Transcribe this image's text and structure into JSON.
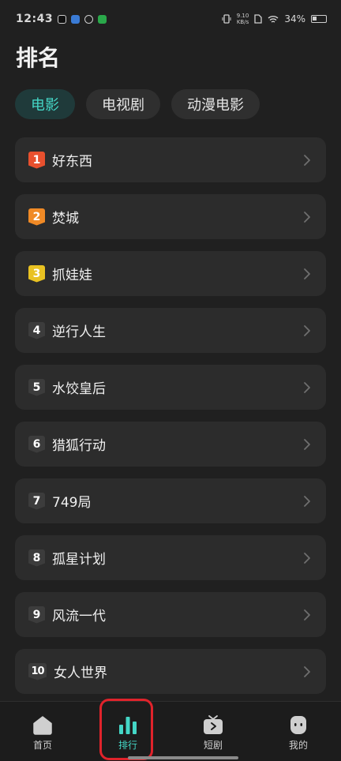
{
  "status": {
    "time": "12:43",
    "net_speed_value": "9.10",
    "net_speed_unit": "KB/s",
    "battery": "34%"
  },
  "page_title": "排名",
  "tabs": [
    {
      "label": "电影",
      "active": true
    },
    {
      "label": "电视剧",
      "active": false
    },
    {
      "label": "动漫电影",
      "active": false
    }
  ],
  "ranking": [
    {
      "rank": "1",
      "title": "好东西"
    },
    {
      "rank": "2",
      "title": "焚城"
    },
    {
      "rank": "3",
      "title": "抓娃娃"
    },
    {
      "rank": "4",
      "title": "逆行人生"
    },
    {
      "rank": "5",
      "title": "水饺皇后"
    },
    {
      "rank": "6",
      "title": "猎狐行动"
    },
    {
      "rank": "7",
      "title": "749局"
    },
    {
      "rank": "8",
      "title": "孤星计划"
    },
    {
      "rank": "9",
      "title": "风流一代"
    },
    {
      "rank": "10",
      "title": "女人世界"
    }
  ],
  "bottom_nav": [
    {
      "label": "首页",
      "icon": "home-icon",
      "active": false
    },
    {
      "label": "排行",
      "icon": "bar-chart-icon",
      "active": true
    },
    {
      "label": "短剧",
      "icon": "tv-play-icon",
      "active": false
    },
    {
      "label": "我的",
      "icon": "profile-face-icon",
      "active": false
    }
  ],
  "colors": {
    "accent": "#44d6c6",
    "background": "#202020",
    "card": "#2c2c2c",
    "rank1": "#e8502e",
    "rank2": "#f08a26",
    "rank3": "#e9c222",
    "highlight": "#e0232b"
  }
}
